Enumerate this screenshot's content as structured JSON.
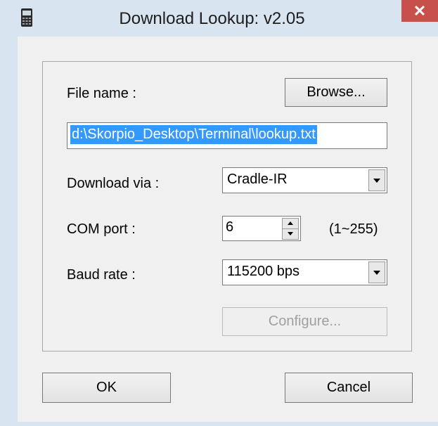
{
  "window": {
    "title": "Download Lookup: v2.05",
    "close_label": "✕",
    "icon": "terminal-device-icon",
    "colors": {
      "frame": "#d9e4f1",
      "close_button": "#c7504a",
      "client": "#f0f0f0",
      "selection": "#3399ff"
    }
  },
  "form": {
    "file_name_label": "File name :",
    "browse_label": "Browse...",
    "file_path": "d:\\Skorpio_Desktop\\Terminal\\lookup.txt",
    "download_via_label": "Download via :",
    "download_via_value": "Cradle-IR",
    "com_port_label": "COM port :",
    "com_port_value": "6",
    "com_port_range": "(1~255)",
    "baud_rate_label": "Baud rate :",
    "baud_rate_value": "115200 bps",
    "configure_label": "Configure..."
  },
  "footer": {
    "ok_label": "OK",
    "cancel_label": "Cancel"
  }
}
